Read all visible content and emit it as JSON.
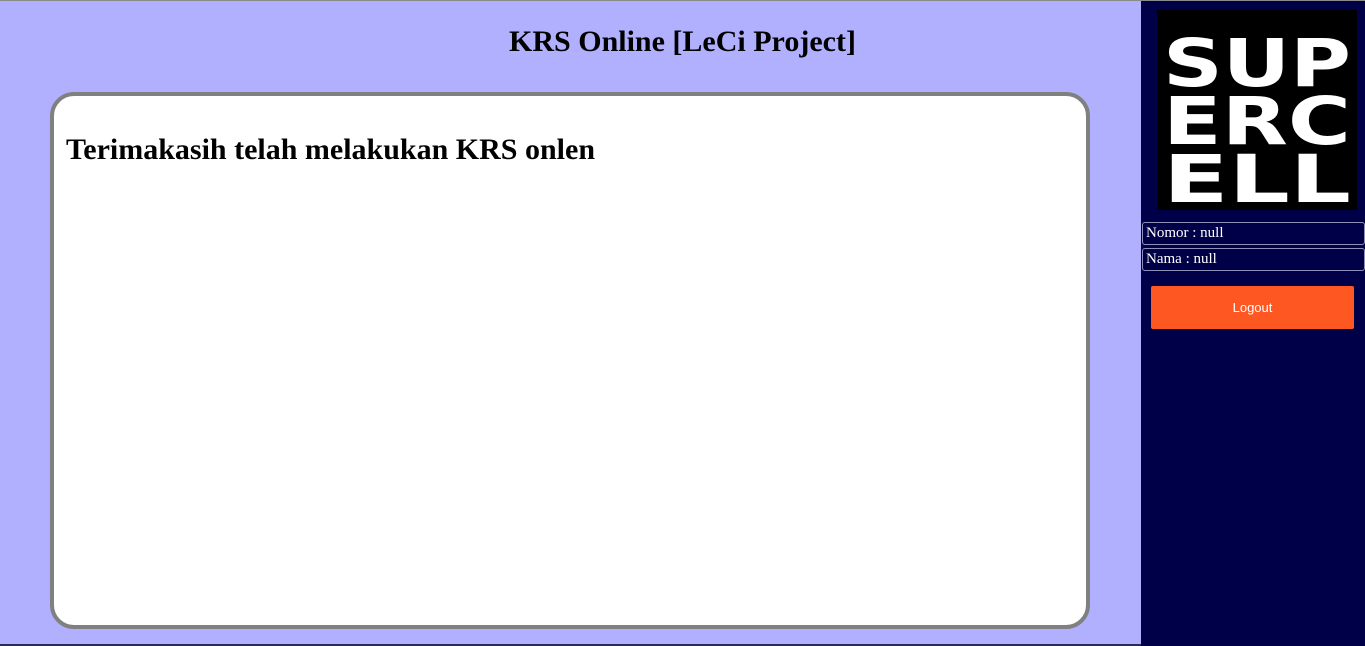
{
  "header": {
    "title": "KRS Online [LeCi Project]"
  },
  "content": {
    "message": "Terimakasih telah melakukan KRS onlen"
  },
  "sidebar": {
    "logo": {
      "text": "SUPERCELL",
      "lines": [
        "SUP",
        "ERC",
        "ELL"
      ]
    },
    "info": {
      "nomor": "Nomor : null",
      "nama": "Nama : null"
    },
    "logout_label": "Logout"
  },
  "colors": {
    "main_background": "#b0b0ff",
    "sidebar_background": "#000048",
    "panel_background": "#ffffff",
    "panel_border": "#808080",
    "logout_button": "#ff5722"
  }
}
